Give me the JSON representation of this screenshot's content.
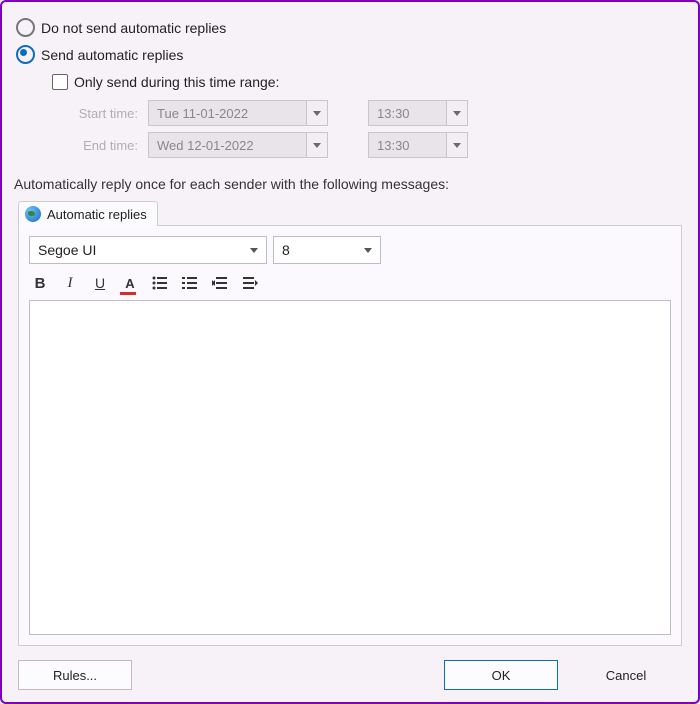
{
  "options": {
    "do_not_send_label": "Do not send automatic replies",
    "send_label": "Send automatic replies",
    "selected": "send",
    "only_during_label": "Only send during this time range:",
    "only_during_checked": false,
    "start_label": "Start time:",
    "end_label": "End time:",
    "start_date": "Tue 11-01-2022",
    "start_time": "13:30",
    "end_date": "Wed 12-01-2022",
    "end_time": "13:30"
  },
  "message_header": "Automatically reply once for each sender with the following messages:",
  "tab": {
    "label": "Automatic replies"
  },
  "editor": {
    "font_name": "Segoe UI",
    "font_size": "8",
    "body_text": ""
  },
  "footer": {
    "rules": "Rules...",
    "ok": "OK",
    "cancel": "Cancel"
  }
}
